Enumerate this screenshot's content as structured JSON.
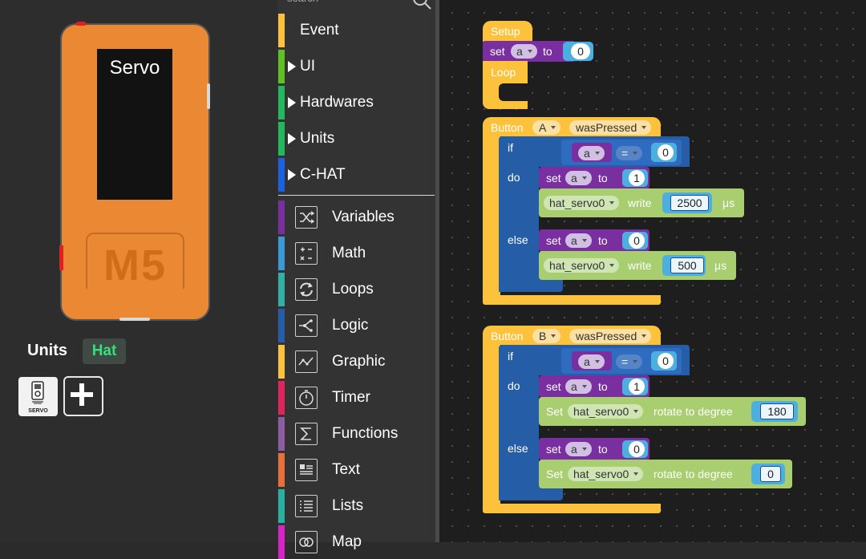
{
  "device": {
    "screen_title": "Servo",
    "logo": "M5",
    "units_label": "Units",
    "hat_badge": "Hat",
    "unit_tile_caption": "SERVO",
    "add_icon": "plus-icon"
  },
  "toolbox": {
    "search_placeholder": "search",
    "expandable": [
      {
        "label": "Event",
        "color": "#fcc23b",
        "arrow": false
      },
      {
        "label": "UI",
        "color": "#5fc222",
        "arrow": true
      },
      {
        "label": "Hardwares",
        "color": "#22b85d",
        "arrow": true
      },
      {
        "label": "Units",
        "color": "#22b85d",
        "arrow": true
      },
      {
        "label": "C-HAT",
        "color": "#1a63e0",
        "arrow": true
      }
    ],
    "categories": [
      {
        "label": "Variables",
        "color": "#7a2fa0",
        "icon": "shuffle-icon"
      },
      {
        "label": "Math",
        "color": "#3a9ad9",
        "icon": "calculator-icon"
      },
      {
        "label": "Loops",
        "color": "#31b0a4",
        "icon": "refresh-icon"
      },
      {
        "label": "Logic",
        "color": "#255da6",
        "icon": "fork-icon"
      },
      {
        "label": "Graphic",
        "color": "#fcc23b",
        "icon": "chart-line-icon"
      },
      {
        "label": "Timer",
        "color": "#e0245e",
        "icon": "stopwatch-icon"
      },
      {
        "label": "Functions",
        "color": "#8e5ca3",
        "icon": "sigma-icon"
      },
      {
        "label": "Text",
        "color": "#e8713a",
        "icon": "text-doc-icon"
      },
      {
        "label": "Lists",
        "color": "#28b0a0",
        "icon": "list-icon"
      },
      {
        "label": "Map",
        "color": "#d624c8",
        "icon": "map-icon"
      }
    ]
  },
  "workspace": {
    "setup": {
      "title": "Setup",
      "set_kw": "set",
      "var": "a",
      "to_kw": "to",
      "value": "0",
      "loop_title": "Loop"
    },
    "button_a": {
      "kw": "Button",
      "button": "A",
      "event": "wasPressed",
      "if_kw": "if",
      "do_kw": "do",
      "else_kw": "else",
      "cond_var": "a",
      "cond_op": "=",
      "cond_value": "0",
      "do_set_kw": "set",
      "do_var": "a",
      "do_to_kw": "to",
      "do_value": "1",
      "do_servo": "hat_servo0",
      "do_write_kw": "write",
      "do_write_value": "2500",
      "do_unit": "μs",
      "else_set_kw": "set",
      "else_var": "a",
      "else_to_kw": "to",
      "else_value": "0",
      "else_servo": "hat_servo0",
      "else_write_kw": "write",
      "else_write_value": "500",
      "else_unit": "μs"
    },
    "button_b": {
      "kw": "Button",
      "button": "B",
      "event": "wasPressed",
      "if_kw": "if",
      "do_kw": "do",
      "else_kw": "else",
      "cond_var": "a",
      "cond_op": "=",
      "cond_value": "0",
      "do_set_kw": "set",
      "do_var": "a",
      "do_to_kw": "to",
      "do_value": "1",
      "do_servo_kw": "Set",
      "do_servo": "hat_servo0",
      "do_rotate_kw": "rotate to degree",
      "do_rotate_value": "180",
      "else_set_kw": "set",
      "else_var": "a",
      "else_to_kw": "to",
      "else_value": "0",
      "else_servo_kw": "Set",
      "else_servo": "hat_servo0",
      "else_rotate_kw": "rotate to degree",
      "else_rotate_value": "0"
    }
  }
}
